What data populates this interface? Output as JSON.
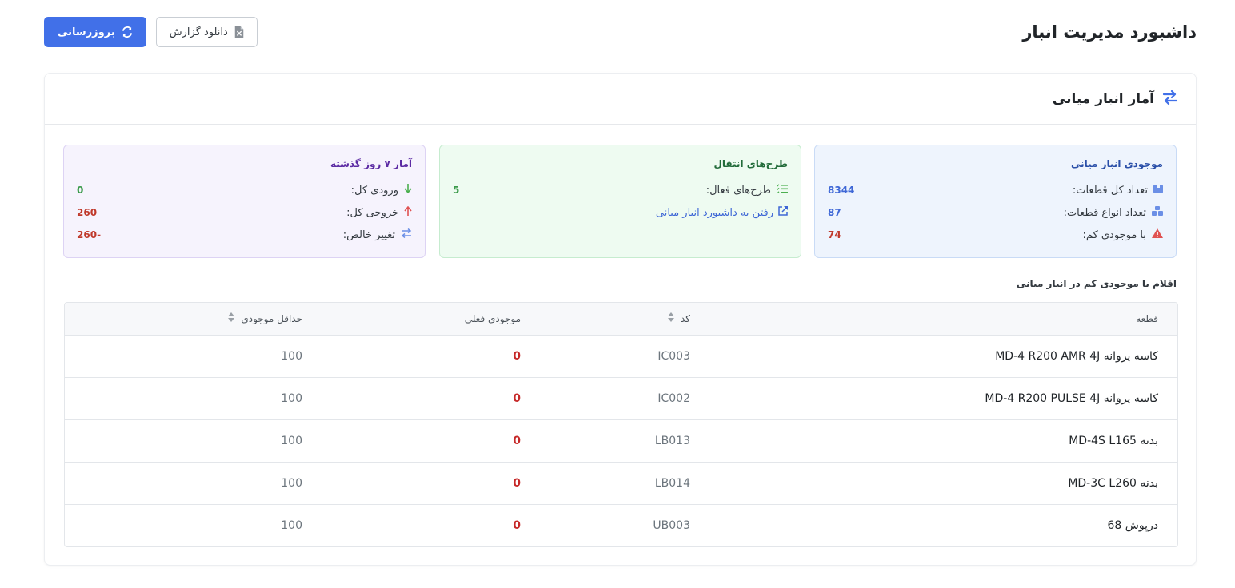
{
  "header": {
    "title": "داشبورد مدیریت انبار",
    "refresh_label": "بروزرسانی",
    "download_label": "دانلود گزارش"
  },
  "card": {
    "title": "آمار انبار میانی"
  },
  "inventory_box": {
    "title": "موجودی انبار میانی",
    "total_parts_label": "تعداد کل قطعات:",
    "total_parts_value": "8344",
    "part_types_label": "تعداد انواع قطعات:",
    "part_types_value": "87",
    "low_stock_label": "با موجودی کم:",
    "low_stock_value": "74"
  },
  "transfer_box": {
    "title": "طرح‌های انتقال",
    "active_label": "طرح‌های فعال:",
    "active_value": "5",
    "link_label": "رفتن به داشبورد انبار میانی"
  },
  "weekly_box": {
    "title": "آمار ۷ روز گذشته",
    "in_label": "ورودی کل:",
    "in_value": "0",
    "out_label": "خروجی کل:",
    "out_value": "260",
    "net_label": "تغییر خالص:",
    "net_value": "-260"
  },
  "low_stock_section": {
    "title": "اقلام با موجودی کم در انبار میانی",
    "columns": [
      "قطعه",
      "کد",
      "موجودی فعلی",
      "حداقل موجودی"
    ],
    "rows": [
      {
        "part": "کاسه پروانه MD-4 R200 AMR 4J",
        "code": "IC003",
        "qty": "0",
        "min": "100"
      },
      {
        "part": "کاسه پروانه MD-4 R200 PULSE 4J",
        "code": "IC002",
        "qty": "0",
        "min": "100"
      },
      {
        "part": "بدنه MD-4S L165",
        "code": "LB013",
        "qty": "0",
        "min": "100"
      },
      {
        "part": "بدنه MD-3C L260",
        "code": "LB014",
        "qty": "0",
        "min": "100"
      },
      {
        "part": "درپوش 68",
        "code": "UB003",
        "qty": "0",
        "min": "100"
      }
    ]
  },
  "colors": {
    "primary": "#4170e8",
    "danger": "#c62828",
    "success": "#3a9a4a"
  }
}
